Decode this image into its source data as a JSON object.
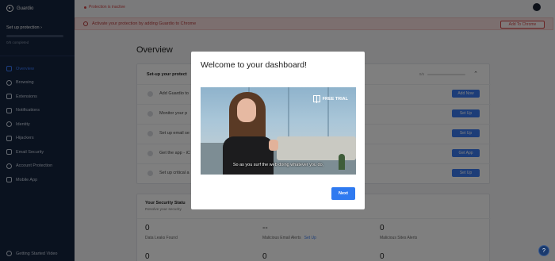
{
  "app": {
    "name": "Guardio"
  },
  "sidebar": {
    "setup_label": "Set up protection",
    "setup_count": "0/5 completed",
    "items": [
      {
        "label": "Overview",
        "icon": "grid-icon",
        "active": true
      },
      {
        "label": "Browsing",
        "icon": "globe-icon"
      },
      {
        "label": "Extensions",
        "icon": "puzzle-icon"
      },
      {
        "label": "Notifications",
        "icon": "bell-icon"
      },
      {
        "label": "Identity",
        "icon": "eye-icon"
      },
      {
        "label": "Hijackers",
        "icon": "shield-icon"
      },
      {
        "label": "Email Security",
        "icon": "mail-icon"
      },
      {
        "label": "Account Protection",
        "icon": "user-icon"
      },
      {
        "label": "Mobile App",
        "icon": "phone-icon"
      }
    ],
    "footer_label": "Getting Started Video"
  },
  "topbar": {
    "status": "Protection is inactive"
  },
  "alert": {
    "text": "Activate your protection by adding Guardio to Chrome",
    "button": "Add To Chrome"
  },
  "main": {
    "title": "Overview",
    "setup_card": {
      "title": "Set-up your protect",
      "progress": "0/5",
      "tasks": [
        {
          "label": "Add Guardio to",
          "button": "Add Now"
        },
        {
          "label": "Monitor your p",
          "button": "Set Up"
        },
        {
          "label": "Set up email se",
          "button": "Set Up"
        },
        {
          "label": "Get the app - iC",
          "button": "Get App"
        },
        {
          "label": "Set up critical a",
          "button": "Set Up"
        }
      ]
    },
    "security_card": {
      "title": "Your Security Statu",
      "subtitle": "Resolve your security",
      "stats": [
        {
          "value": "0",
          "label": "Data Leaks Found"
        },
        {
          "value": "--",
          "label": "Malicious Email Alerts",
          "link": "Set Up"
        },
        {
          "value": "0",
          "label": "Malicious Sites Alerts"
        }
      ],
      "stats_row2": [
        "0",
        "0",
        "0"
      ]
    }
  },
  "modal": {
    "title": "Welcome to your dashboard!",
    "video_badge": "FREE TRIAL",
    "video_caption": "So as you surf the web doing whatever you do,",
    "next_button": "Next"
  },
  "help_icon": "?",
  "colors": {
    "sidebar_bg": "#14243f",
    "accent": "#3b7bf0",
    "alert": "#d24545"
  }
}
